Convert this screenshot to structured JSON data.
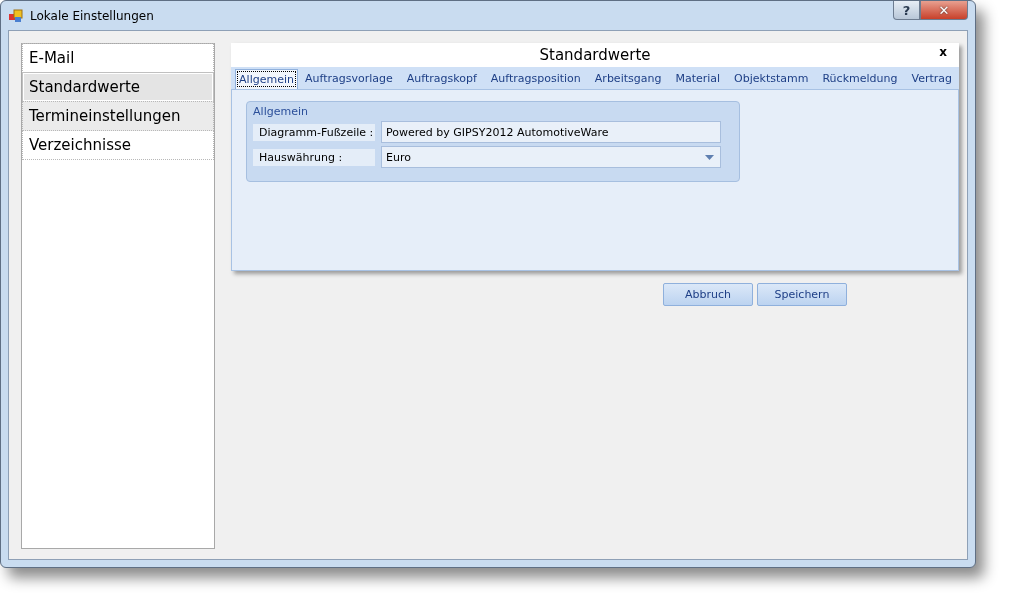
{
  "window": {
    "title": "Lokale Einstellungen",
    "buttons": [
      "?",
      "✕"
    ]
  },
  "sidebar": {
    "items": [
      {
        "label": "E-Mail",
        "selected": false,
        "hover": false
      },
      {
        "label": "Standardwerte",
        "selected": true,
        "hover": false
      },
      {
        "label": "Termineinstellungen",
        "selected": false,
        "hover": true
      },
      {
        "label": "Verzeichnisse",
        "selected": false,
        "hover": false
      }
    ]
  },
  "panel": {
    "title": "Standardwerte",
    "close": "x",
    "tabs": [
      {
        "label": "Allgemein",
        "selected": true
      },
      {
        "label": "Auftragsvorlage",
        "selected": false
      },
      {
        "label": "Auftragskopf",
        "selected": false
      },
      {
        "label": "Auftragsposition",
        "selected": false
      },
      {
        "label": "Arbeitsgang",
        "selected": false
      },
      {
        "label": "Material",
        "selected": false
      },
      {
        "label": "Objektstamm",
        "selected": false
      },
      {
        "label": "Rückmeldung",
        "selected": false
      },
      {
        "label": "Vertrag",
        "selected": false
      }
    ],
    "group": {
      "title": "Allgemein",
      "fields": [
        {
          "kind": "text",
          "label": "Diagramm-Fußzeile :",
          "value": "Powered by GIPSY2012 AutomotiveWare"
        },
        {
          "kind": "dropdown",
          "label": "Hauswährung :",
          "value": "Euro"
        }
      ]
    }
  },
  "buttons": [
    "Abbruch",
    "Speichern"
  ]
}
